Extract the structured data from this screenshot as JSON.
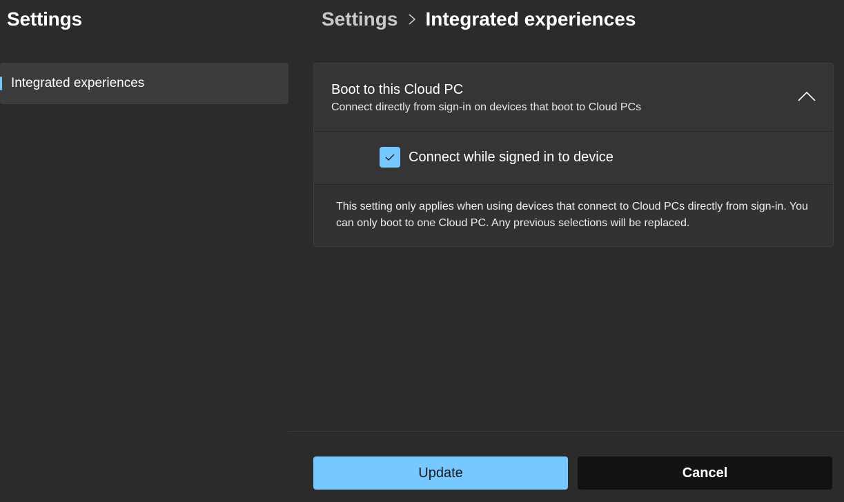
{
  "app": {
    "title": "Settings"
  },
  "sidebar": {
    "items": [
      {
        "label": "Integrated experiences",
        "selected": true
      }
    ]
  },
  "breadcrumb": {
    "root": "Settings",
    "separator_icon": "chevron-right-icon",
    "current": "Integrated experiences"
  },
  "card": {
    "title": "Boot to this Cloud PC",
    "subtitle": "Connect directly from sign-in on devices that boot to Cloud PCs",
    "expanded": true,
    "collapse_icon": "chevron-up-icon",
    "option": {
      "label": "Connect while signed in to device",
      "checked": true
    },
    "note": "This setting only applies when using devices that connect to Cloud PCs directly from sign-in. You can only boot to one Cloud PC. Any previous selections will be replaced."
  },
  "footer": {
    "primary_label": "Update",
    "secondary_label": "Cancel"
  },
  "colors": {
    "background": "#2b2b2b",
    "accent": "#76c8ff",
    "card": "#323232",
    "secondary_button": "#121212"
  }
}
